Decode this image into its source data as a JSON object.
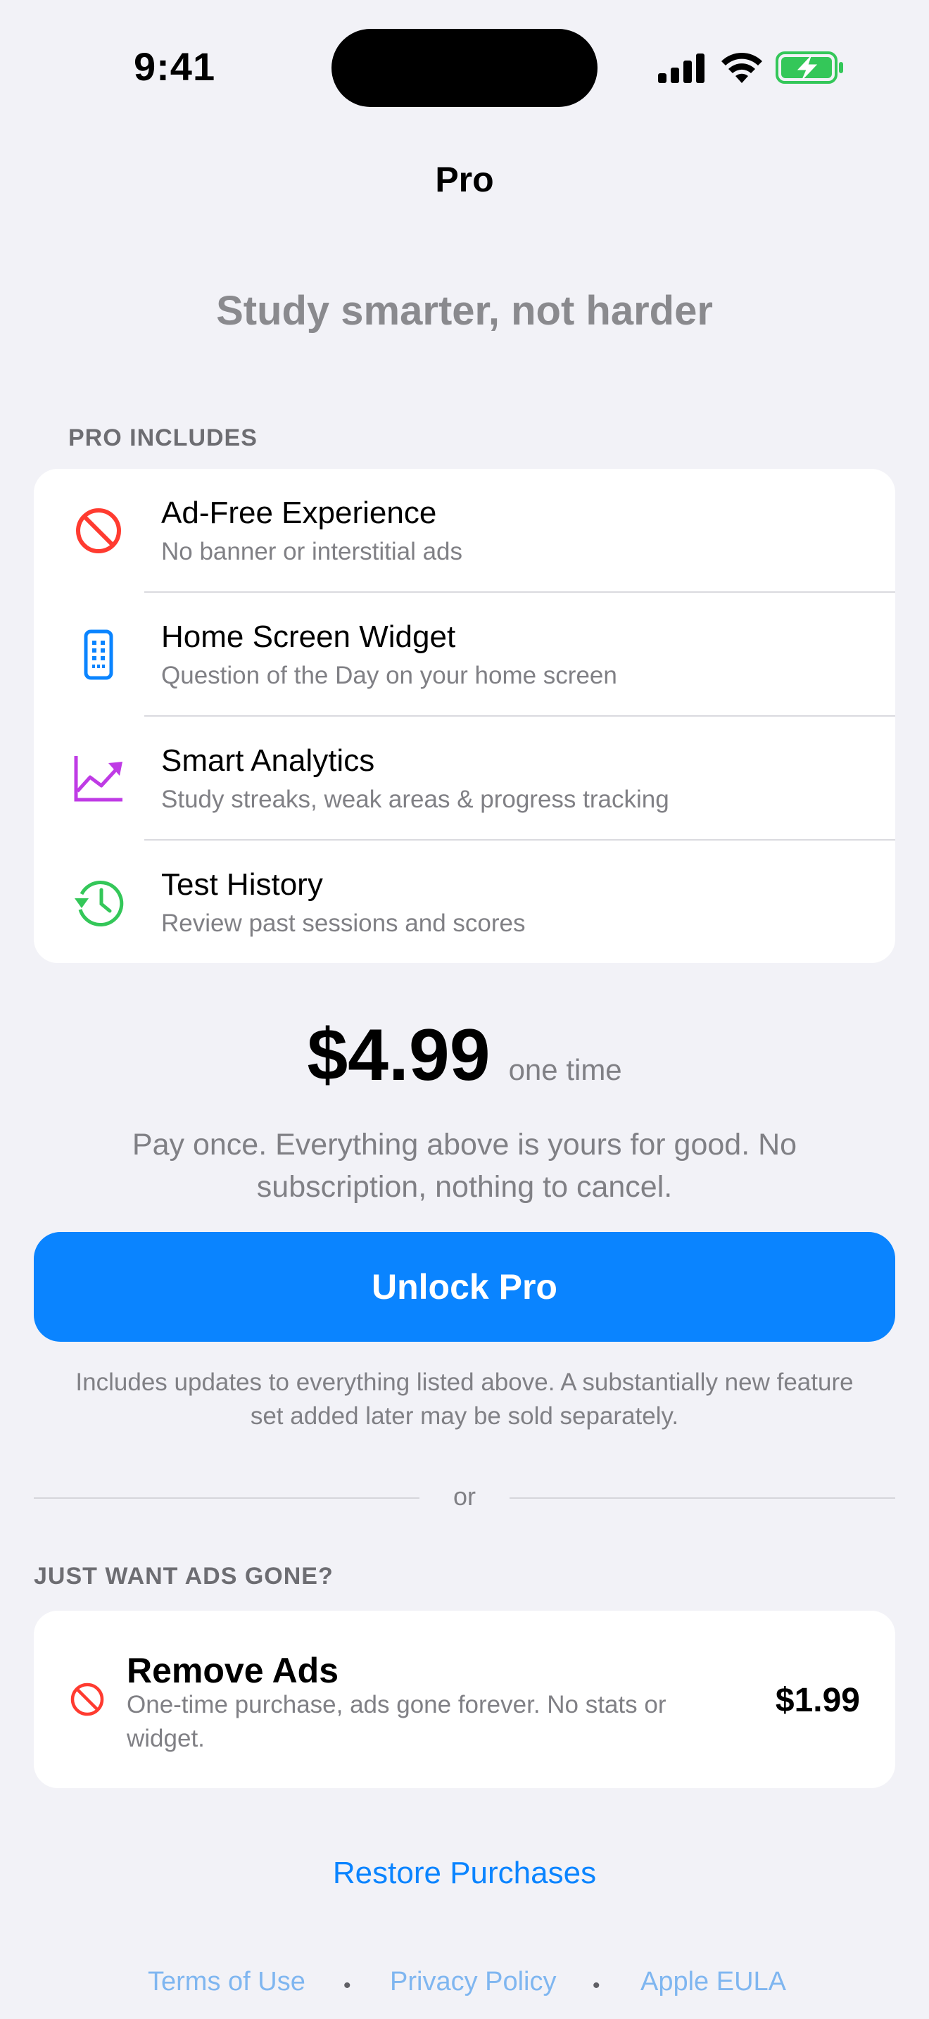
{
  "status_bar": {
    "time": "9:41"
  },
  "nav": {
    "title": "Pro"
  },
  "tagline": "Study smarter, not harder",
  "pro_includes": {
    "header": "PRO INCLUDES",
    "features": [
      {
        "title": "Ad-Free Experience",
        "subtitle": "No banner or interstitial ads",
        "icon": "no-ads-icon",
        "color": "#FF3B30"
      },
      {
        "title": "Home Screen Widget",
        "subtitle": "Question of the Day on your home screen",
        "icon": "widget-icon",
        "color": "#0A84FF"
      },
      {
        "title": "Smart Analytics",
        "subtitle": "Study streaks, weak areas & progress tracking",
        "icon": "chart-icon",
        "color": "#BF3BE5"
      },
      {
        "title": "Test History",
        "subtitle": "Review past sessions and scores",
        "icon": "history-icon",
        "color": "#34C759"
      }
    ]
  },
  "pricing": {
    "price": "$4.99",
    "suffix": "one time",
    "description": "Pay once. Everything above is yours for good. No subscription, nothing to cancel.",
    "button_label": "Unlock Pro",
    "fine_print": "Includes updates to everything listed above. A substantially new feature set added later may be sold separately."
  },
  "separator": {
    "text": "or"
  },
  "remove_ads": {
    "header": "JUST WANT ADS GONE?",
    "title": "Remove Ads",
    "subtitle": "One-time purchase, ads gone forever. No stats or widget.",
    "price": "$1.99"
  },
  "restore": {
    "label": "Restore Purchases"
  },
  "footer": {
    "links": [
      "Terms of Use",
      "Privacy Policy",
      "Apple EULA"
    ],
    "separator": "•"
  },
  "colors": {
    "accent": "#0A84FF",
    "background": "#F2F2F7"
  }
}
